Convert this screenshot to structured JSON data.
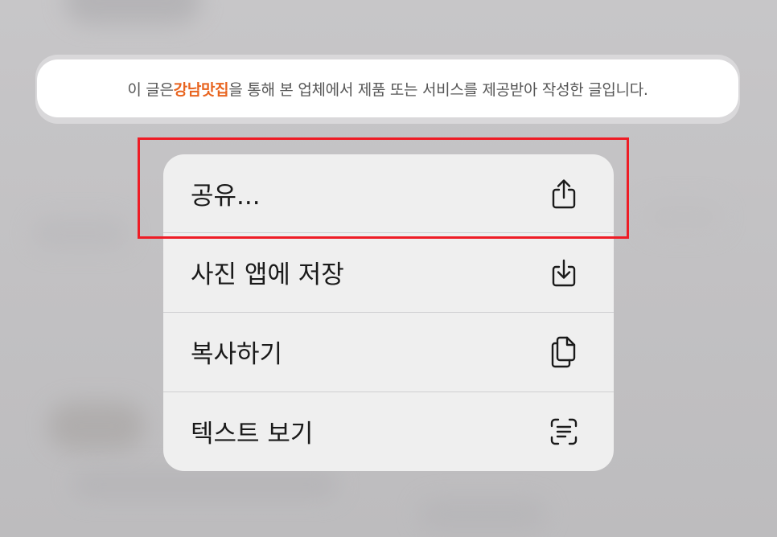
{
  "notice": {
    "prefix": "이 글은 ",
    "highlight": "강남맛집",
    "suffix": "을 통해 본 업체에서 제품 또는 서비스를 제공받아 작성한 글입니다."
  },
  "context_menu": {
    "items": [
      {
        "label": "공유...",
        "icon": "share-icon"
      },
      {
        "label": "사진 앱에 저장",
        "icon": "save-to-photos-icon"
      },
      {
        "label": "복사하기",
        "icon": "copy-icon"
      },
      {
        "label": "텍스트 보기",
        "icon": "live-text-icon"
      }
    ]
  },
  "colors": {
    "highlight_text": "#e8641f",
    "annotation_box": "#ee1c25",
    "menu_background": "#efefef"
  }
}
